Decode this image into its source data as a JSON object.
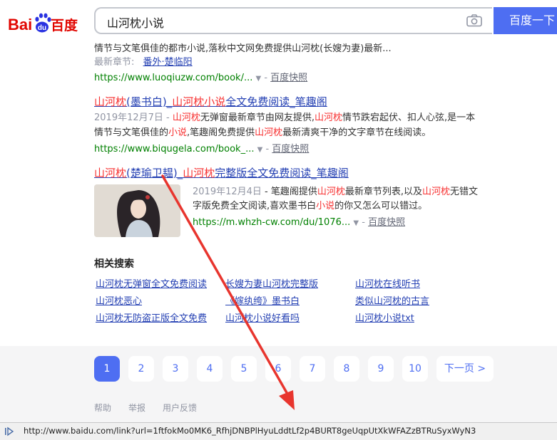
{
  "search": {
    "query": "山河枕小说",
    "button_label": "百度一下"
  },
  "logo": {
    "text_bai": "Bai",
    "text_du": "du",
    "text_cn": "百度"
  },
  "result0": {
    "snippet_line": "情节与文笔俱佳的都市小说,落秋中文网免费提供山河枕(长嫂为妻)最新...",
    "latest_label": "最新章节:",
    "latest_link": "番外·楚临阳",
    "url": "https://www.luoqiuzw.com/book/...",
    "kuaizhao": "百度快照"
  },
  "result1": {
    "title_a": "山河枕",
    "title_b": "(墨书白)_",
    "title_c": "山河枕小说",
    "title_d": "全文免费阅读_笔趣阁",
    "date": "2019年12月7日",
    "line1_a": " - ",
    "line1_b": "山河枕",
    "line1_c": "无弹窗最新章节由网友提供,",
    "line1_d": "山河枕",
    "line1_e": "情节跌宕起伏、扣人心弦,是一本",
    "line2_a": "情节与文笔俱佳的",
    "line2_b": "小说",
    "line2_c": ",笔趣阁免费提供",
    "line2_d": "山河枕",
    "line2_e": "最新清爽干净的文字章节在线阅读。",
    "url": "https://www.biqugela.com/book_...",
    "kuaizhao": "百度快照"
  },
  "result2": {
    "title_a": "山河枕",
    "title_b": "(楚瑜卫韫)_",
    "title_c": "山河枕",
    "title_d": "完整版全文免费阅读_笔趣阁",
    "date": "2019年12月4日",
    "line1_a": " - 笔趣阁提供",
    "line1_b": "山河枕",
    "line1_c": "最新章节列表,以及",
    "line1_d": "山河枕",
    "line1_e": "无错文",
    "line2_a": "字版免费全文阅读,喜欢墨书白",
    "line2_b": "小说",
    "line2_c": "的你又怎么可以错过。",
    "url": "https://m.whzh-cw.com/du/1076...",
    "kuaizhao": "百度快照"
  },
  "related": {
    "heading": "相关搜索",
    "items": [
      "山河枕无弹窗全文免费阅读",
      "长嫂为妻山河枕完整版",
      "山河枕在线听书",
      "山河枕恶心",
      "《嫁纨绔》墨书白",
      "类似山河枕的古言",
      "山河枕无防盗正版全文免费",
      "山河枕小说好看吗",
      "山河枕小说txt"
    ]
  },
  "pager": {
    "pages": [
      "1",
      "2",
      "3",
      "4",
      "5",
      "6",
      "7",
      "8",
      "9",
      "10"
    ],
    "current": "1",
    "next": "下一页 >"
  },
  "footer": {
    "help": "帮助",
    "report": "举报",
    "feedback": "用户反馈"
  },
  "status_bar": {
    "url": "http://www.baidu.com/link?url=1ftfokMo0MK6_RfhjDNBPlHyuLddtLf2p4BURT8geUqpUtXkWFAZzBTRuSyxWyN3"
  },
  "colors": {
    "accent": "#4e6ef2",
    "link": "#2440b3",
    "highlight": "#f73131",
    "url_green": "#008000",
    "annotation": "#e8352e"
  },
  "icons": [
    "camera-icon",
    "paw-icon",
    "dropdown-arrow-icon",
    "play-icon"
  ]
}
